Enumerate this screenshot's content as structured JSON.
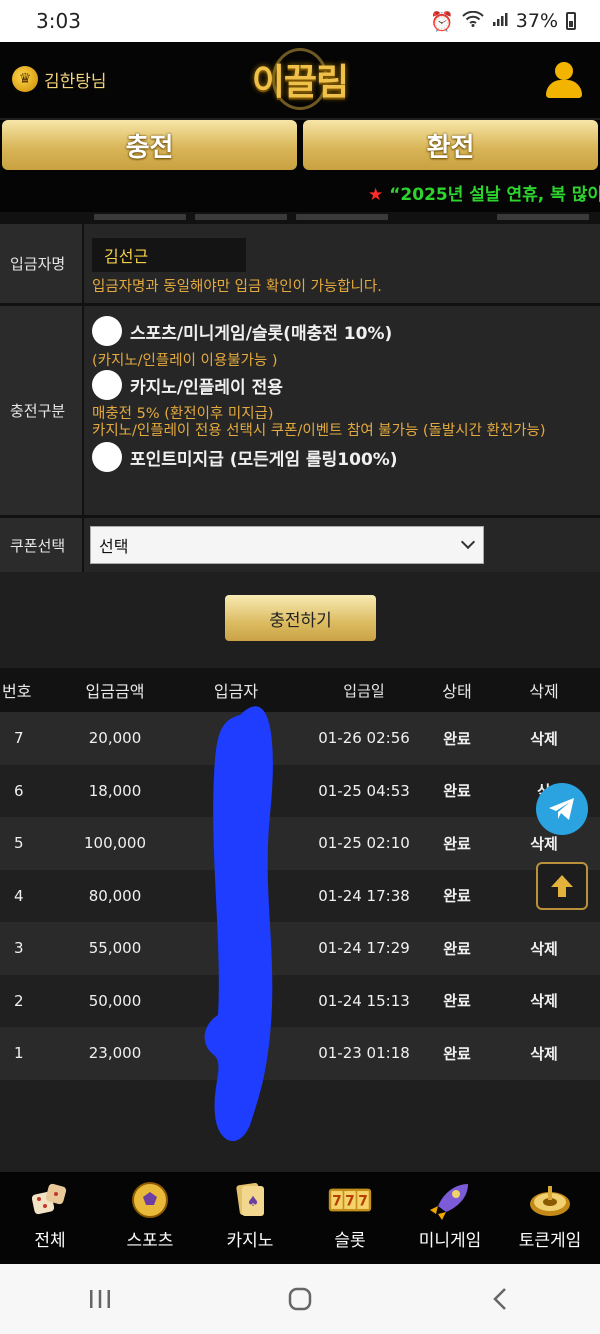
{
  "status_bar": {
    "time": "3:03",
    "battery": "37%"
  },
  "header": {
    "username": "김한탕님",
    "logo": "이끌림"
  },
  "tabs": {
    "charge": "충전",
    "exchange": "환전"
  },
  "notice": "“2025년 설날 연휴, 복 많이",
  "form": {
    "depositor_label": "입금자명",
    "depositor_value": "김선근",
    "depositor_note": "입금자명과 동일해야만 입금 확인이 가능합니다.",
    "charge_type_label": "충전구분",
    "options": [
      {
        "label": "스포츠/미니게임/슬롯(매충전 10%)",
        "note": "(카지노/인플레이 이용불가능 )"
      },
      {
        "label": "카지노/인플레이 전용",
        "note": "매충전 5% (환전이후 미지급)\n카지노/인플레이 전용 선택시 쿠폰/이벤트 참여 불가능 (돌발시간 환전가능)"
      },
      {
        "label": "포인트미지급 (모든게임 롤링100%)",
        "note": ""
      }
    ],
    "coupon_label": "쿠폰선택",
    "coupon_value": "선택",
    "submit": "충전하기"
  },
  "table": {
    "headers": [
      "번호",
      "입금금액",
      "입금자",
      "입금일",
      "상태",
      "삭제"
    ],
    "rows": [
      {
        "no": "7",
        "amount": "20,000",
        "date": "01-26 02:56",
        "status": "완료",
        "delete": "삭제"
      },
      {
        "no": "6",
        "amount": "18,000",
        "date": "01-25 04:53",
        "status": "완료",
        "delete": "삭"
      },
      {
        "no": "5",
        "amount": "100,000",
        "date": "01-25 02:10",
        "status": "완료",
        "delete": "삭제"
      },
      {
        "no": "4",
        "amount": "80,000",
        "date": "01-24 17:38",
        "status": "완료",
        "delete": ""
      },
      {
        "no": "3",
        "amount": "55,000",
        "date": "01-24 17:29",
        "status": "완료",
        "delete": "삭제"
      },
      {
        "no": "2",
        "amount": "50,000",
        "date": "01-24 15:13",
        "status": "완료",
        "delete": "삭제"
      },
      {
        "no": "1",
        "amount": "23,000",
        "date": "01-23 01:18",
        "status": "완료",
        "delete": "삭제"
      }
    ]
  },
  "bottom_nav": [
    {
      "label": "전체",
      "icon": "dice-icon"
    },
    {
      "label": "스포츠",
      "icon": "soccer-ball-icon"
    },
    {
      "label": "카지노",
      "icon": "cards-icon"
    },
    {
      "label": "슬롯",
      "icon": "slot-777-icon"
    },
    {
      "label": "미니게임",
      "icon": "rocket-icon"
    },
    {
      "label": "토큰게임",
      "icon": "roulette-icon"
    }
  ],
  "colors": {
    "gold": "#d9b659",
    "notice_green": "#2ed42e",
    "note_orange": "#e3a93f",
    "telegram_blue": "#2aa3e0"
  }
}
